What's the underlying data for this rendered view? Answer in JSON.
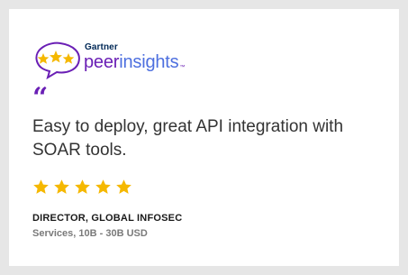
{
  "logo": {
    "brand": "Gartner",
    "name_part1": "peer",
    "name_part2": "insights",
    "trademark": "™",
    "colors": {
      "purple": "#6a1fb5",
      "blue": "#4d6fdf",
      "navy": "#002856",
      "gold": "#f5b800"
    }
  },
  "review": {
    "quote_mark": "“",
    "text": "Easy to deploy, great API integration with SOAR tools.",
    "rating": 5,
    "rating_max": 5,
    "star_color": "#f5b800",
    "reviewer_role": "DIRECTOR, GLOBAL INFOSEC",
    "reviewer_company": "Services, 10B - 30B USD"
  }
}
